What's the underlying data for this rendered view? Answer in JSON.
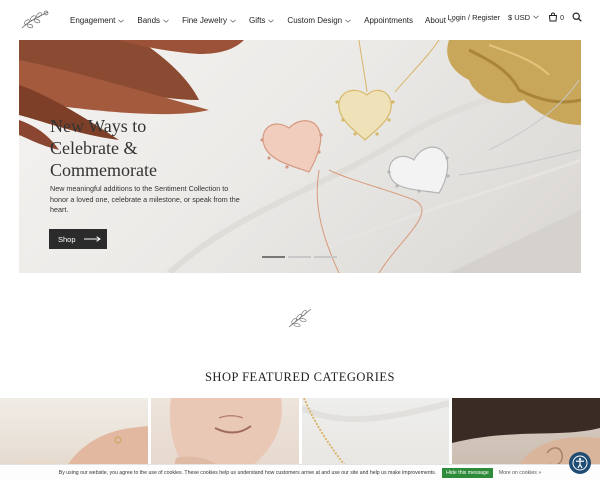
{
  "nav": {
    "items": [
      {
        "label": "Engagement",
        "dropdown": true
      },
      {
        "label": "Bands",
        "dropdown": true
      },
      {
        "label": "Fine Jewelry",
        "dropdown": true
      },
      {
        "label": "Gifts",
        "dropdown": true
      },
      {
        "label": "Custom Design",
        "dropdown": true
      },
      {
        "label": "Appointments",
        "dropdown": false
      },
      {
        "label": "About",
        "dropdown": true
      }
    ],
    "login_label": "Login / Register",
    "currency_label": "$ USD",
    "cart_count": "0"
  },
  "hero": {
    "title_lines": [
      "New Ways to",
      "Celebrate &",
      "Commemorate"
    ],
    "description": "New meaningful additions to the Sentiment Collection to honor a loved one, celebrate a milestone, or speak from the heart.",
    "button_label": "Shop",
    "slide_count": 3,
    "active_slide": 1
  },
  "featured": {
    "title": "SHOP FEATURED CATEGORIES"
  },
  "cookie": {
    "text": "By using our website, you agree to the use of cookies. These cookies help us understand how customers arrive at and use our site and help us make improvements.",
    "hide_label": "Hide this message",
    "more_label": "More on cookies »"
  },
  "colors": {
    "text": "#222222",
    "button_dark": "#2b2b2b",
    "cookie_green": "#2e8b3a",
    "a11y_blue": "#1f4d74"
  },
  "icons": [
    "logo-sprig",
    "chevron-down-icon",
    "cart-icon",
    "search-icon",
    "arrow-right-icon",
    "sprig-divider-icon",
    "accessibility-icon"
  ]
}
